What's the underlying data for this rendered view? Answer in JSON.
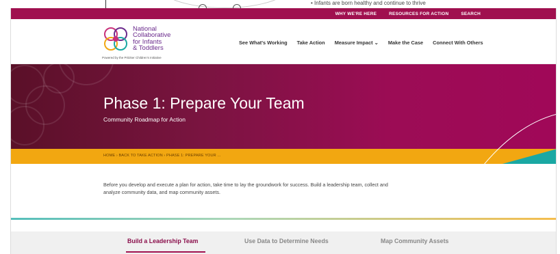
{
  "backdrop": {
    "bullet_text": "•  Infants are born healthy and continue to thrive"
  },
  "topbar": {
    "links": [
      "WHY WE'RE HERE",
      "RESOURCES FOR ACTION",
      "SEARCH"
    ]
  },
  "logo": {
    "line1": "National",
    "line2": "Collaborative",
    "line3": "for Infants",
    "line4": "& Toddlers",
    "powered": "Powered by the Pritzker Children's Initiative"
  },
  "nav": {
    "items": [
      "See What's Working",
      "Take Action",
      "Measure Impact ⌄",
      "Make the Case",
      "Connect With Others"
    ]
  },
  "hero": {
    "title": "Phase 1: Prepare Your Team",
    "subtitle": "Community Roadmap for Action"
  },
  "breadcrumb": {
    "trail": "HOME  ›  BACK TO TAKE ACTION  ›  PHASE 1: PREPARE YOUR ..."
  },
  "intro": {
    "text": "Before you develop and execute a plan for action, take time to lay the groundwork for success. Build a leadership team, collect and analyze community data, and map community assets."
  },
  "tabs": {
    "items": [
      "Build a Leadership Team",
      "Use Data to Determine Needs",
      "Map Community Assets"
    ],
    "active_index": 0
  },
  "colors": {
    "brand": "#a0104f",
    "accent_gold": "#f2a711",
    "accent_teal": "#1aa8a3"
  }
}
